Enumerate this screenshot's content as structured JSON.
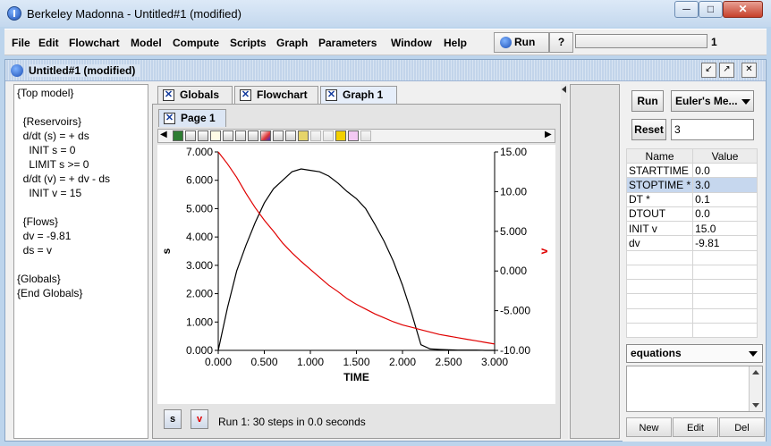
{
  "window": {
    "title": "Berkeley Madonna - Untitled#1 (modified)",
    "minimize_glyph": "─",
    "maximize_glyph": "□",
    "close_glyph": "✕"
  },
  "menu": [
    "File",
    "Edit",
    "Flowchart",
    "Model",
    "Compute",
    "Scripts",
    "Graph",
    "Parameters",
    "Window",
    "Help"
  ],
  "toolbar": {
    "run_label": "Run",
    "help_glyph": "?",
    "progress_value": "1"
  },
  "document": {
    "title": "Untitled#1 (modified)"
  },
  "equations": [
    "{Top model}",
    "",
    "  {Reservoirs}",
    "  d/dt (s) = + ds",
    "    INIT s = 0",
    "    LIMIT s >= 0",
    "  d/dt (v) = + dv - ds",
    "    INIT v = 15",
    "",
    "  {Flows}",
    "  dv = -9.81",
    "  ds = v",
    "",
    "{Globals}",
    "{End Globals}"
  ],
  "tabs": [
    {
      "label": "Globals",
      "active": false
    },
    {
      "label": "Flowchart",
      "active": false
    },
    {
      "label": "Graph 1",
      "active": true
    }
  ],
  "page_tab": "Page 1",
  "graph_buttons": {
    "s": "s",
    "v": "v"
  },
  "status_text": "Run 1: 30 steps in 0.0 seconds",
  "right_panel": {
    "run_label": "Run",
    "method_label": "Euler's Me...",
    "reset_label": "Reset",
    "reset_value": "3",
    "table_headers": [
      "Name",
      "Value"
    ],
    "params": [
      {
        "name": "STARTTIME",
        "value": "0.0"
      },
      {
        "name": "STOPTIME *",
        "value": "3.0"
      },
      {
        "name": "DT *",
        "value": "0.1"
      },
      {
        "name": "DTOUT",
        "value": "0.0"
      },
      {
        "name": "INIT v",
        "value": "15.0"
      },
      {
        "name": "dv",
        "value": "-9.81"
      }
    ],
    "selected_row": 1,
    "list_select": "equations",
    "buttons": [
      "New",
      "Edit",
      "Del"
    ]
  },
  "chart_data": {
    "type": "line",
    "xlabel": "TIME",
    "ylabel_left": "s",
    "ylabel_right": "v",
    "xlim": [
      0,
      3
    ],
    "ylim_left": [
      0,
      7
    ],
    "ylim_right": [
      -10,
      15
    ],
    "x_ticks": [
      "0.000",
      "0.500",
      "1.000",
      "1.500",
      "2.000",
      "2.500",
      "3.000"
    ],
    "y_ticks_left": [
      "0.000",
      "1.000",
      "2.000",
      "3.000",
      "4.000",
      "5.000",
      "6.000",
      "7.000"
    ],
    "y_ticks_right": [
      "-10.00",
      "-5.000",
      "0.000",
      "5.000",
      "10.00",
      "15.00"
    ],
    "series": [
      {
        "name": "s",
        "axis": "left",
        "color": "#000000",
        "x": [
          0,
          0.1,
          0.2,
          0.3,
          0.4,
          0.5,
          0.6,
          0.7,
          0.8,
          0.9,
          1.0,
          1.1,
          1.2,
          1.3,
          1.4,
          1.5,
          1.6,
          1.7,
          1.8,
          1.9,
          2.0,
          2.1,
          2.2,
          2.3,
          2.4,
          2.5,
          2.6,
          2.7,
          2.8,
          2.9,
          3.0
        ],
        "y": [
          0,
          1.5,
          2.8,
          3.7,
          4.5,
          5.2,
          5.7,
          6.0,
          6.3,
          6.4,
          6.35,
          6.3,
          6.15,
          5.9,
          5.6,
          5.35,
          5.0,
          4.45,
          3.85,
          3.15,
          2.3,
          1.3,
          0.2,
          0.05,
          0.03,
          0.02,
          0.01,
          0.01,
          0.01,
          0.0,
          0.0
        ]
      },
      {
        "name": "v",
        "axis": "right",
        "color": "#e00000",
        "x": [
          0,
          0.1,
          0.2,
          0.3,
          0.4,
          0.5,
          0.6,
          0.7,
          0.8,
          0.9,
          1.0,
          1.1,
          1.2,
          1.3,
          1.4,
          1.5,
          1.6,
          1.7,
          1.8,
          1.9,
          2.0,
          2.1,
          2.2,
          2.3,
          2.4,
          2.5,
          2.6,
          2.7,
          2.8,
          2.9,
          3.0
        ],
        "y": [
          15.0,
          13.5,
          11.8,
          9.8,
          8.0,
          6.4,
          5.0,
          3.5,
          2.3,
          1.2,
          0.2,
          -0.8,
          -1.8,
          -2.6,
          -3.5,
          -4.2,
          -4.8,
          -5.4,
          -5.9,
          -6.4,
          -6.8,
          -7.1,
          -7.4,
          -7.7,
          -8.0,
          -8.2,
          -8.4,
          -8.6,
          -8.8,
          -9.0,
          -9.2
        ]
      }
    ],
    "grid": false
  }
}
